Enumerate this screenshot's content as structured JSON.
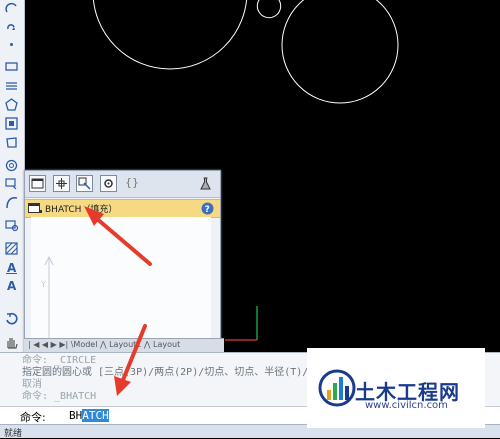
{
  "palette": {
    "hatch_item": "BHATCH（填充）"
  },
  "layout_tabs": {
    "text": "| ◀ ◀ ▶ ▶| \\Model ⋀ Layout1 ⋀ Layout"
  },
  "command": {
    "history": [
      "命令:  _CIRCLE",
      "指定圆的圆心或 [三点(3P)/两点(2P)/切点、切点、半径(T)/弧线(A)/多次(M)]:",
      "取消",
      "命令:  _BHATCH"
    ],
    "prompt": "命令:",
    "typed_prefix": "BH",
    "typed_selected": "ATCH"
  },
  "status": {
    "text": "就绪"
  },
  "watermark": {
    "title": "土木工程网",
    "url": "www.civilcn.com"
  },
  "colors": {
    "accent_red": "#e53b2c",
    "highlight": "#f5d983",
    "selection": "#2f8bd9"
  }
}
